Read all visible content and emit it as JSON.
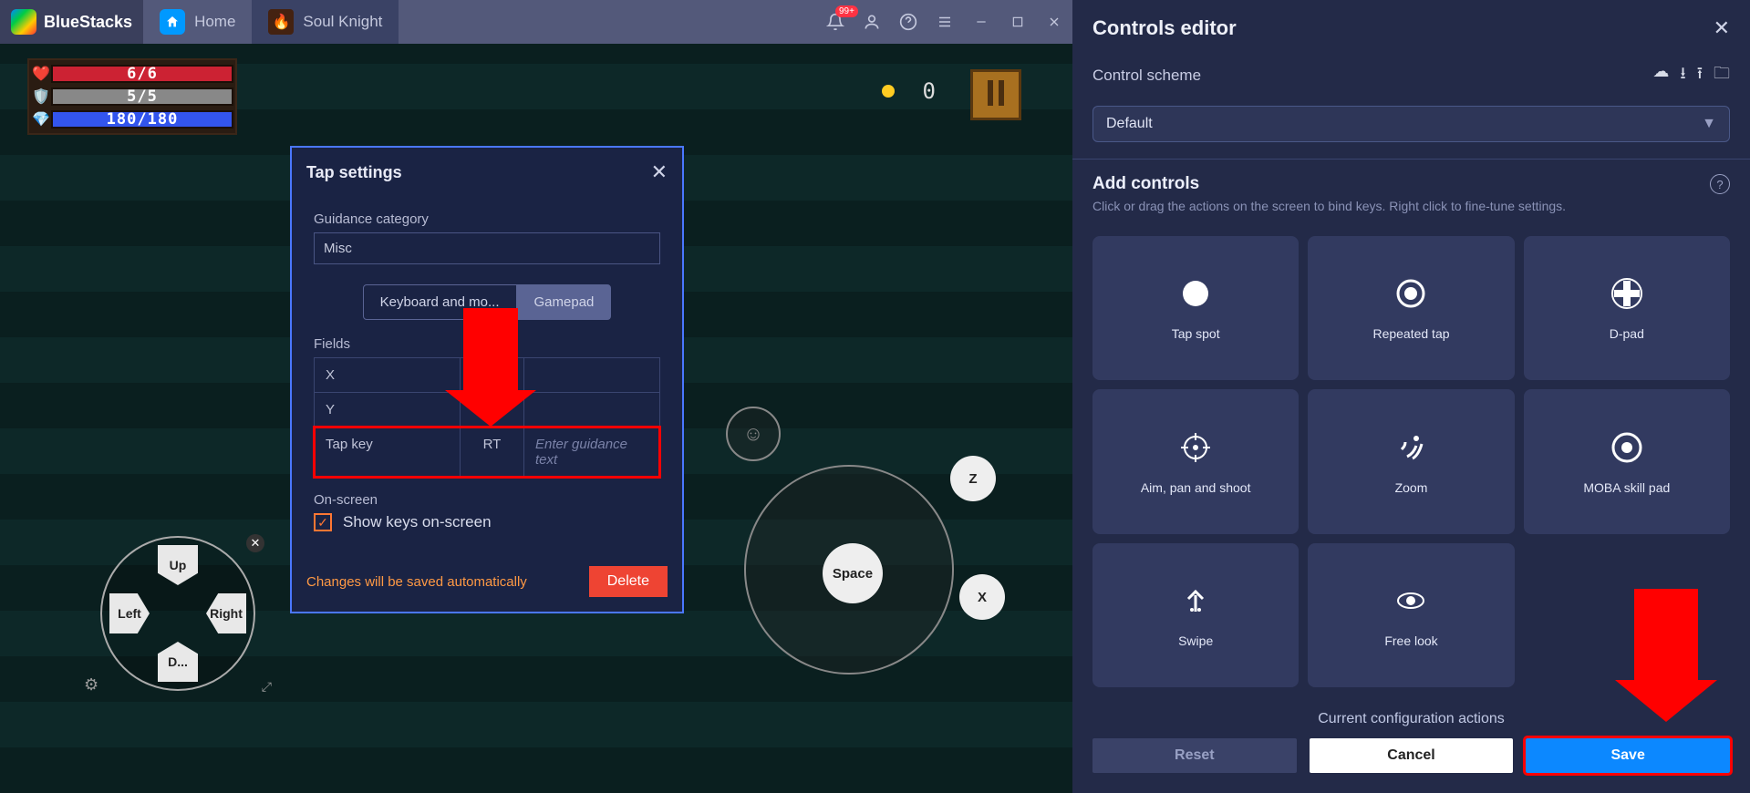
{
  "titlebar": {
    "app_name": "BlueStacks",
    "home_label": "Home",
    "active_tab": "Soul Knight",
    "notification_badge": "99+"
  },
  "hud": {
    "hp": "6/6",
    "ap": "5/5",
    "mp": "180/180"
  },
  "score": "0",
  "settings": {
    "title": "Tap settings",
    "guidance_category_label": "Guidance category",
    "guidance_category_value": "Misc",
    "mode_keyboard": "Keyboard and mo...",
    "mode_gamepad": "Gamepad",
    "fields_label": "Fields",
    "rows": [
      {
        "label": "X",
        "value": "",
        "guide": ""
      },
      {
        "label": "Y",
        "value": "",
        "guide": ""
      },
      {
        "label": "Tap key",
        "value": "RT",
        "guide": "Enter guidance text"
      }
    ],
    "onscreen_label": "On-screen",
    "show_keys_label": "Show keys on-screen",
    "autosave": "Changes will be saved automatically",
    "delete": "Delete"
  },
  "dpad": {
    "up": "Up",
    "down": "D...",
    "left": "Left",
    "right": "Right"
  },
  "keys": {
    "z": "Z",
    "x": "X",
    "space": "Space"
  },
  "controls_panel": {
    "title": "Controls editor",
    "scheme_label": "Control scheme",
    "scheme_value": "Default",
    "add_title": "Add controls",
    "add_sub": "Click or drag the actions on the screen to bind keys. Right click to fine-tune settings.",
    "cards": [
      "Tap spot",
      "Repeated tap",
      "D-pad",
      "Aim, pan and shoot",
      "Zoom",
      "MOBA skill pad",
      "Swipe",
      "Free look",
      ""
    ],
    "config_text": "Current configuration actions",
    "reset": "Reset",
    "cancel": "Cancel",
    "save": "Save"
  }
}
